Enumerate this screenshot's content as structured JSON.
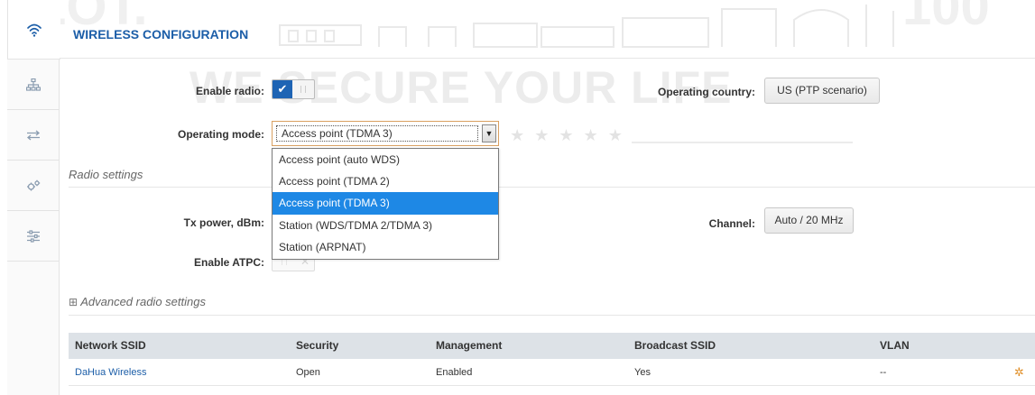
{
  "page": {
    "title": "WIRELESS CONFIGURATION",
    "watermark_slogan": "WE SECURE YOUR LIFE",
    "watermark_left": "LOT.",
    "watermark_right": "100",
    "watermark_stars": "★ ★ ★ ★ ★ ★"
  },
  "sidebar": {
    "items": [
      {
        "icon": "wifi-icon",
        "active": true
      },
      {
        "icon": "network-tree-icon",
        "active": false
      },
      {
        "icon": "transfer-arrows-icon",
        "active": false
      },
      {
        "icon": "gears-icon",
        "active": false
      },
      {
        "icon": "sliders-icon",
        "active": false
      }
    ]
  },
  "form": {
    "enable_radio_label": "Enable radio:",
    "enable_radio_on": true,
    "operating_country_label": "Operating country:",
    "operating_country_value": "US (PTP scenario)",
    "operating_mode_label": "Operating mode:",
    "operating_mode_value": "Access point (TDMA 3)",
    "operating_mode_options": [
      "Access point (auto WDS)",
      "Access point (TDMA 2)",
      "Access point (TDMA 3)",
      "Station (WDS/TDMA 2/TDMA 3)",
      "Station (ARPNAT)"
    ],
    "operating_mode_selected_index": 2
  },
  "radio_settings": {
    "title": "Radio settings",
    "tx_power_label": "Tx power, dBm:",
    "channel_label": "Channel:",
    "channel_value": "Auto / 20 MHz",
    "enable_atpc_label": "Enable ATPC:",
    "enable_atpc_on": false
  },
  "advanced": {
    "expand_glyph": "⊞",
    "title": "Advanced radio settings"
  },
  "ssid_table": {
    "headers": [
      "Network SSID",
      "Security",
      "Management",
      "Broadcast SSID",
      "VLAN"
    ],
    "rows": [
      {
        "ssid": "DaHua Wireless",
        "security": "Open",
        "management": "Enabled",
        "broadcast": "Yes",
        "vlan": "--"
      }
    ]
  },
  "colors": {
    "accent": "#1c5ea8",
    "selected_option": "#1e88e5",
    "gear": "#e0902a"
  }
}
